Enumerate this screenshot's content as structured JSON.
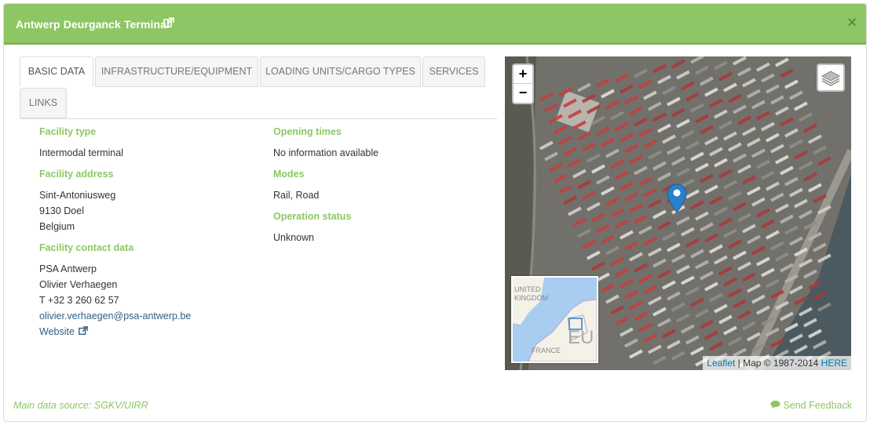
{
  "header": {
    "title": "Antwerp Deurganck Terminal",
    "close_label": "×"
  },
  "tabs": [
    {
      "label": "BASIC DATA",
      "active": true
    },
    {
      "label": "INFRASTRUCTURE/EQUIPMENT",
      "active": false
    },
    {
      "label": "LOADING UNITS/CARGO TYPES",
      "active": false
    },
    {
      "label": "SERVICES",
      "active": false
    },
    {
      "label": "LINKS",
      "active": false
    }
  ],
  "basic": {
    "facility_type_label": "Facility type",
    "facility_type": "Intermodal terminal",
    "address_label": "Facility address",
    "address_line1": "Sint-Antoniusweg",
    "address_line2": "9130 Doel",
    "address_line3": "Belgium",
    "contact_label": "Facility contact data",
    "contact_company": "PSA Antwerp",
    "contact_person": "Olivier Verhaegen",
    "contact_phone": "T +32 3 260 62 57",
    "contact_email": "olivier.verhaegen@psa-antwerp.be",
    "website_label": "Website",
    "opening_label": "Opening times",
    "opening": "No information available",
    "modes_label": "Modes",
    "modes": "Rail, Road",
    "status_label": "Operation status",
    "status": "Unknown"
  },
  "map": {
    "zoom_in": "+",
    "zoom_out": "−",
    "attribution_link": "Leaflet",
    "attribution_text": " | Map © 1987-2014 ",
    "attribution_here": "HERE",
    "minimap_labels": [
      "UNITED",
      "KINGDOM",
      "FRANCE",
      "EU"
    ]
  },
  "footer": {
    "source": "Main data source: SGKV/UIRR",
    "feedback": "Send Feedback"
  },
  "colors": {
    "accent": "#8dc765",
    "link": "#2f5f85",
    "marker": "#2a81cb"
  },
  "icons": {
    "external": "external-link-icon",
    "close": "close-icon",
    "layers": "layers-icon",
    "marker": "map-marker-icon",
    "feedback": "comment-icon"
  }
}
